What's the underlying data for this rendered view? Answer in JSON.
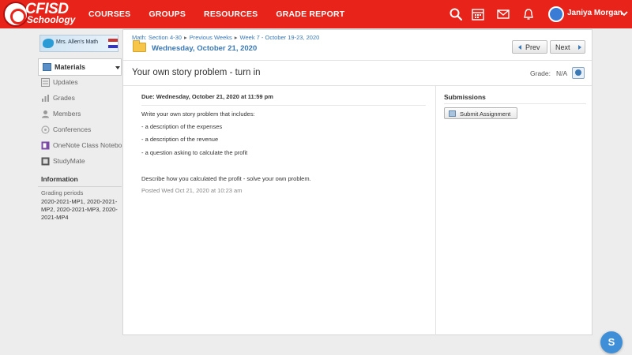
{
  "brand": {
    "name": "CFISD",
    "sub": "Schoology"
  },
  "nav": {
    "items": [
      "COURSES",
      "GROUPS",
      "RESOURCES",
      "GRADE REPORT"
    ]
  },
  "header_icons": [
    "search-icon",
    "calendar-icon",
    "mail-icon",
    "notification-bell-icon"
  ],
  "user": {
    "name": "Janiya Morgan"
  },
  "sidebar": {
    "course_image_text": "Mrs. Allen's Math",
    "materials_label": "Materials",
    "items": [
      {
        "label": "Updates",
        "icon": "updates-icon"
      },
      {
        "label": "Grades",
        "icon": "grades-icon"
      },
      {
        "label": "Members",
        "icon": "members-icon"
      },
      {
        "label": "Conferences",
        "icon": "conferences-icon"
      },
      {
        "label": "OneNote Class Notebo...",
        "icon": "onenote-icon"
      },
      {
        "label": "StudyMate",
        "icon": "studymate-icon"
      }
    ],
    "info_title": "Information",
    "grading_periods_label": "Grading periods",
    "grading_periods_value": "2020-2021-MP1, 2020-2021-MP2, 2020-2021-MP3, 2020-2021-MP4"
  },
  "breadcrumb": [
    "Math: Section 4-30",
    "Previous Weeks",
    "Week 7 - October 19-23, 2020"
  ],
  "folder_title": "Wednesday, October 21, 2020",
  "buttons": {
    "prev": "Prev",
    "next": "Next",
    "submit": "Submit Assignment"
  },
  "assignment": {
    "title": "Your own story problem - turn in",
    "grade_label": "Grade:",
    "grade_value": "N/A",
    "due": "Due: Wednesday, October 21, 2020 at 11:59 pm",
    "body": [
      "Write your own story problem that includes:",
      "- a description of the expenses",
      "- a description of the revenue",
      "- a question asking to calculate the profit",
      "Describe how you calculated the profit - solve your own problem."
    ],
    "posted": "Posted Wed Oct 21, 2020 at 10:23 am"
  },
  "submissions_title": "Submissions",
  "help_button": "S",
  "colors": {
    "brand_red": "#e8231a",
    "link_blue": "#3a78b5"
  }
}
